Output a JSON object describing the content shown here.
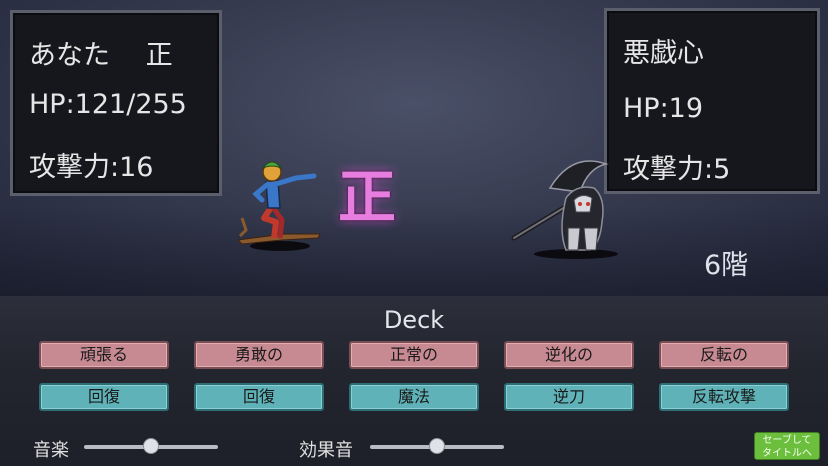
{
  "player": {
    "name_line": "あなた　 正",
    "hp": "HP:121/255",
    "attack": "攻撃力:16"
  },
  "enemy": {
    "name": "悪戯心",
    "hp": "HP:19",
    "attack": "攻撃力:5"
  },
  "center_kanji": "正",
  "floor": "6階",
  "deck": {
    "title": "Deck",
    "row1": [
      "頑張る",
      "勇敢の",
      "正常の",
      "逆化の",
      "反転の"
    ],
    "row2": [
      "回復",
      "回復",
      "魔法",
      "逆刀",
      "反転攻撃"
    ]
  },
  "settings": {
    "music_label": "音楽",
    "music_level": 0.5,
    "sfx_label": "効果音",
    "sfx_level": 0.5
  },
  "save_button": {
    "line1": "セーブして",
    "line2": "タイトルへ"
  },
  "colors": {
    "accent_kanji": "#e87de0",
    "card_pink": "#c88a92",
    "card_teal": "#5fb3b8",
    "save_green": "#6cbf3c"
  }
}
